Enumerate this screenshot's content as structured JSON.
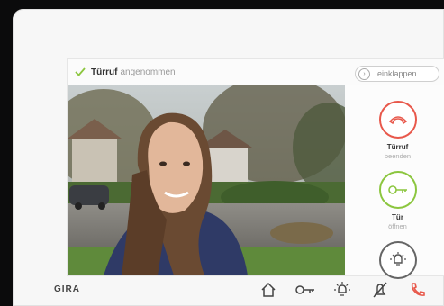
{
  "status_bar": {
    "strong_text": "Türruf",
    "rest_text": "angenommen"
  },
  "collapse_button": {
    "label": "einklappen"
  },
  "actions": [
    {
      "name": "end-call",
      "line1": "Türruf",
      "line2": "beenden",
      "icon": "phone-hangup-icon",
      "color": "#e8584b"
    },
    {
      "name": "open-door",
      "line1": "Tür",
      "line2": "öffnen",
      "icon": "key-icon",
      "color": "#8cc63f"
    },
    {
      "name": "light",
      "line1": "",
      "line2": "",
      "icon": "light-icon",
      "color": "#555555"
    }
  ],
  "brand": "GIRA",
  "nav_icons": [
    "home-icon",
    "key-icon",
    "light-icon",
    "mute-icon",
    "phone-icon"
  ],
  "colors": {
    "hangup": "#e8584b",
    "door_open": "#8cc63f",
    "accept": "#8cc63f"
  }
}
